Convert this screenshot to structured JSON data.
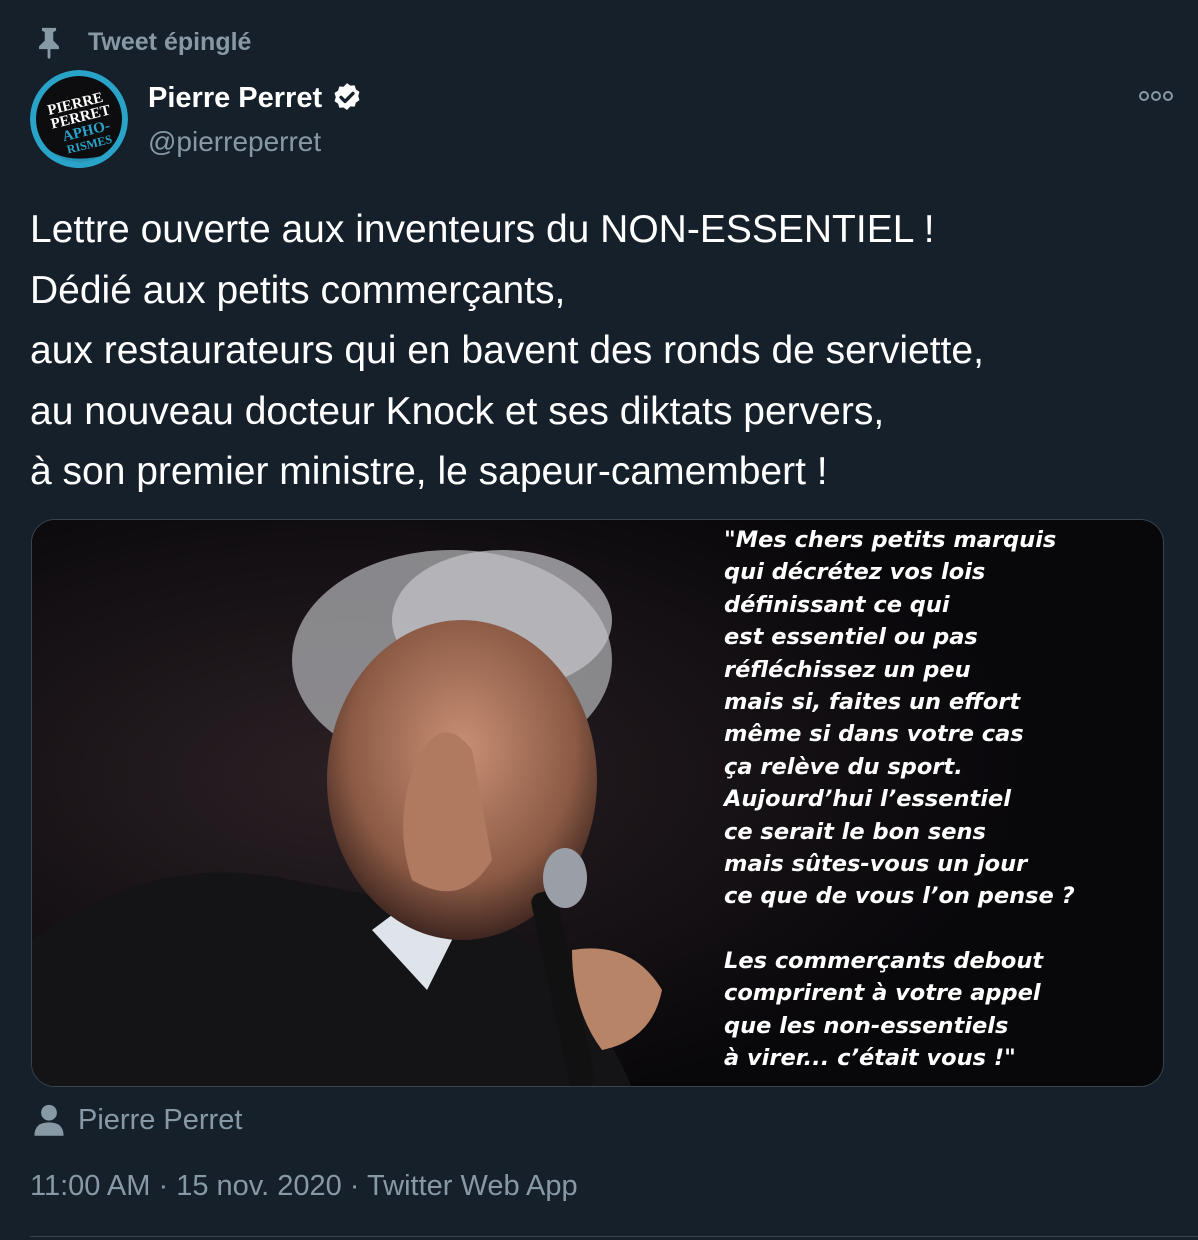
{
  "pinned": {
    "label": "Tweet épinglé",
    "icon": "pin-icon"
  },
  "author": {
    "display_name": "Pierre Perret",
    "handle": "@pierreperret",
    "verified": true,
    "avatar": {
      "line1": "PIERRE",
      "line2": "PERRET",
      "line3": "APHO-",
      "line4": "RISMES",
      "ring_color": "#2aa3c9"
    }
  },
  "more_icon": "more-icon",
  "tweet": {
    "lines": [
      "Lettre ouverte aux inventeurs du NON-ESSENTIEL !",
      "Dédié aux petits commerçants,",
      "aux restaurateurs qui en bavent des ronds de serviette,",
      "au nouveau docteur Knock et ses diktats pervers,",
      "à son premier ministre, le sapeur-camembert !"
    ]
  },
  "media": {
    "quote_lines": [
      "\"Mes chers petits marquis",
      "qui décrétez vos lois",
      "définissant ce qui",
      "est essentiel ou pas",
      "réfléchissez un peu",
      "mais si, faites un effort",
      "même si dans votre cas",
      "ça relève du sport.",
      "Aujourd’hui l’essentiel",
      "ce serait le bon sens",
      "mais sûtes-vous un jour",
      "ce que de vous l’on pense ?",
      "",
      "Les commerçants debout",
      "comprirent à votre appel",
      "que les non-essentiels",
      "à virer... c’était vous !\""
    ]
  },
  "tagged": {
    "icon": "person-icon",
    "name": "Pierre Perret"
  },
  "meta": {
    "time": "11:00 AM",
    "separator": "·",
    "date": "15 nov. 2020",
    "source": "Twitter Web App"
  },
  "colors": {
    "background": "#15202b",
    "secondary_text": "#8899a6",
    "border": "#38444d",
    "verified": "#ffffff"
  }
}
